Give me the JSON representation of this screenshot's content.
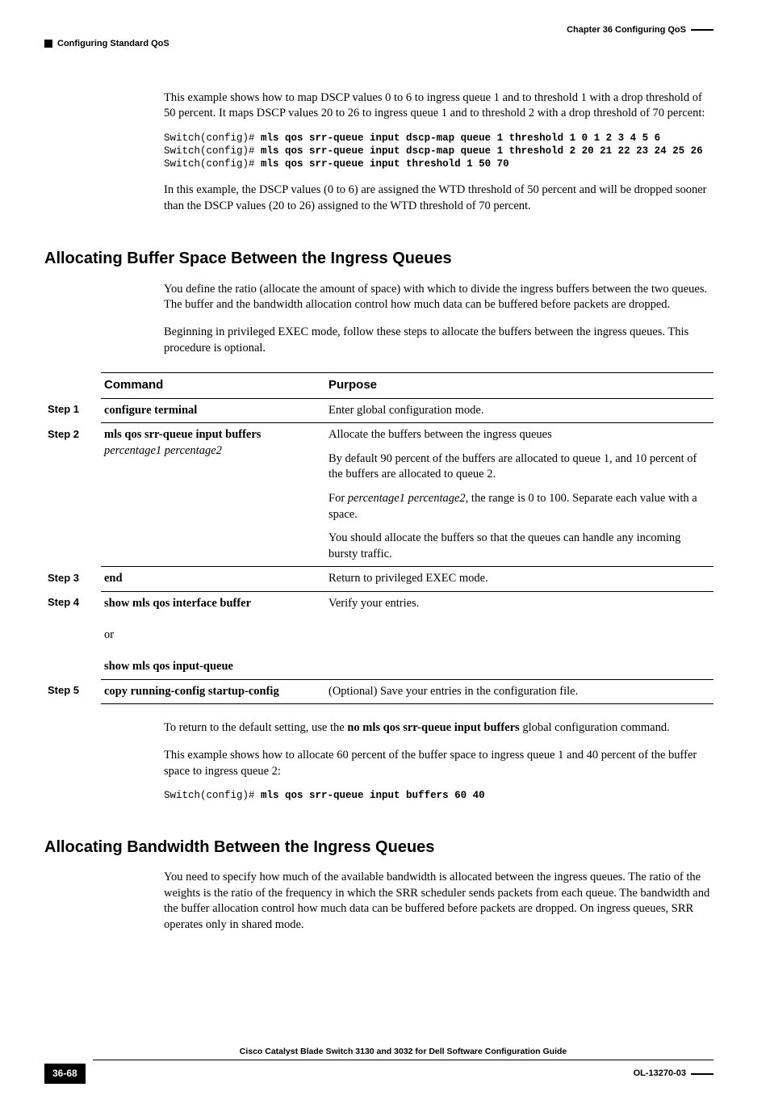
{
  "header": {
    "chapter": "Chapter 36      Configuring QoS",
    "section": "Configuring Standard QoS"
  },
  "intro": {
    "p1": "This example shows how to map DSCP values 0 to 6 to ingress queue 1 and to threshold 1 with a drop threshold of 50 percent. It maps DSCP values 20 to 26 to ingress queue 1 and to threshold 2 with a drop threshold of 70 percent:",
    "code_prompt": "Switch(config)# ",
    "code1": "mls qos srr-queue input dscp-map queue 1 threshold 1 0 1 2 3 4 5 6",
    "code2": "mls qos srr-queue input dscp-map queue 1 threshold 2 20 21 22 23 24 25 26",
    "code3": "mls qos srr-queue input threshold 1 50 70",
    "p2": "In this example, the DSCP values (0 to 6) are assigned the WTD threshold of 50 percent and will be dropped sooner than the DSCP values (20 to 26) assigned to the WTD threshold of 70 percent."
  },
  "sec1": {
    "title": "Allocating Buffer Space Between the Ingress Queues",
    "p1": "You define the ratio (allocate the amount of space) with which to divide the ingress buffers between the two queues. The buffer and the bandwidth allocation control how much data can be buffered before packets are dropped.",
    "p2": "Beginning in privileged EXEC mode, follow these steps to allocate the buffers between the ingress queues. This procedure is optional.",
    "table": {
      "h1": "Command",
      "h2": "Purpose",
      "steps": [
        {
          "s": "Step 1",
          "cmd": "configure terminal",
          "purpose": "Enter global configuration mode."
        },
        {
          "s": "Step 2",
          "cmd": "mls qos srr-queue input buffers",
          "cmd_i": "percentage1 percentage2",
          "purpose1": "Allocate the buffers between the ingress queues",
          "purpose2": "By default 90 percent of the buffers are allocated to queue 1, and 10 percent of the buffers are allocated to queue 2.",
          "purpose3a": "For ",
          "purpose3i": "percentage1 percentage2,",
          "purpose3b": " the range is 0 to 100. Separate each value with a space.",
          "purpose4": "You should allocate the buffers so that the queues can handle any incoming bursty traffic."
        },
        {
          "s": "Step 3",
          "cmd": "end",
          "purpose": "Return to privileged EXEC mode."
        },
        {
          "s": "Step 4",
          "cmd1": "show mls qos interface buffer",
          "or": "or",
          "cmd2": "show mls qos input-queue",
          "purpose": "Verify your entries."
        },
        {
          "s": "Step 5",
          "cmd": "copy running-config startup-config",
          "purpose": "(Optional) Save your entries in the configuration file."
        }
      ]
    },
    "after1a": "To return to the default setting, use the ",
    "after1b": "no mls qos srr-queue input buffers",
    "after1c": " global configuration command.",
    "after2": "This example shows how to allocate 60 percent of the buffer space to ingress queue 1 and 40 percent of the buffer space to ingress queue 2:",
    "code": "mls qos srr-queue input buffers 60 40"
  },
  "sec2": {
    "title": "Allocating Bandwidth Between the Ingress Queues",
    "p1": "You need to specify how much of the available bandwidth is allocated between the ingress queues. The ratio of the weights is the ratio of the frequency in which the SRR scheduler sends packets from each queue. The bandwidth and the buffer allocation control how much data can be buffered before packets are dropped. On ingress queues, SRR operates only in shared mode."
  },
  "footer": {
    "title": "Cisco Catalyst Blade Switch 3130 and 3032 for Dell Software Configuration Guide",
    "page": "36-68",
    "doc": "OL-13270-03"
  }
}
